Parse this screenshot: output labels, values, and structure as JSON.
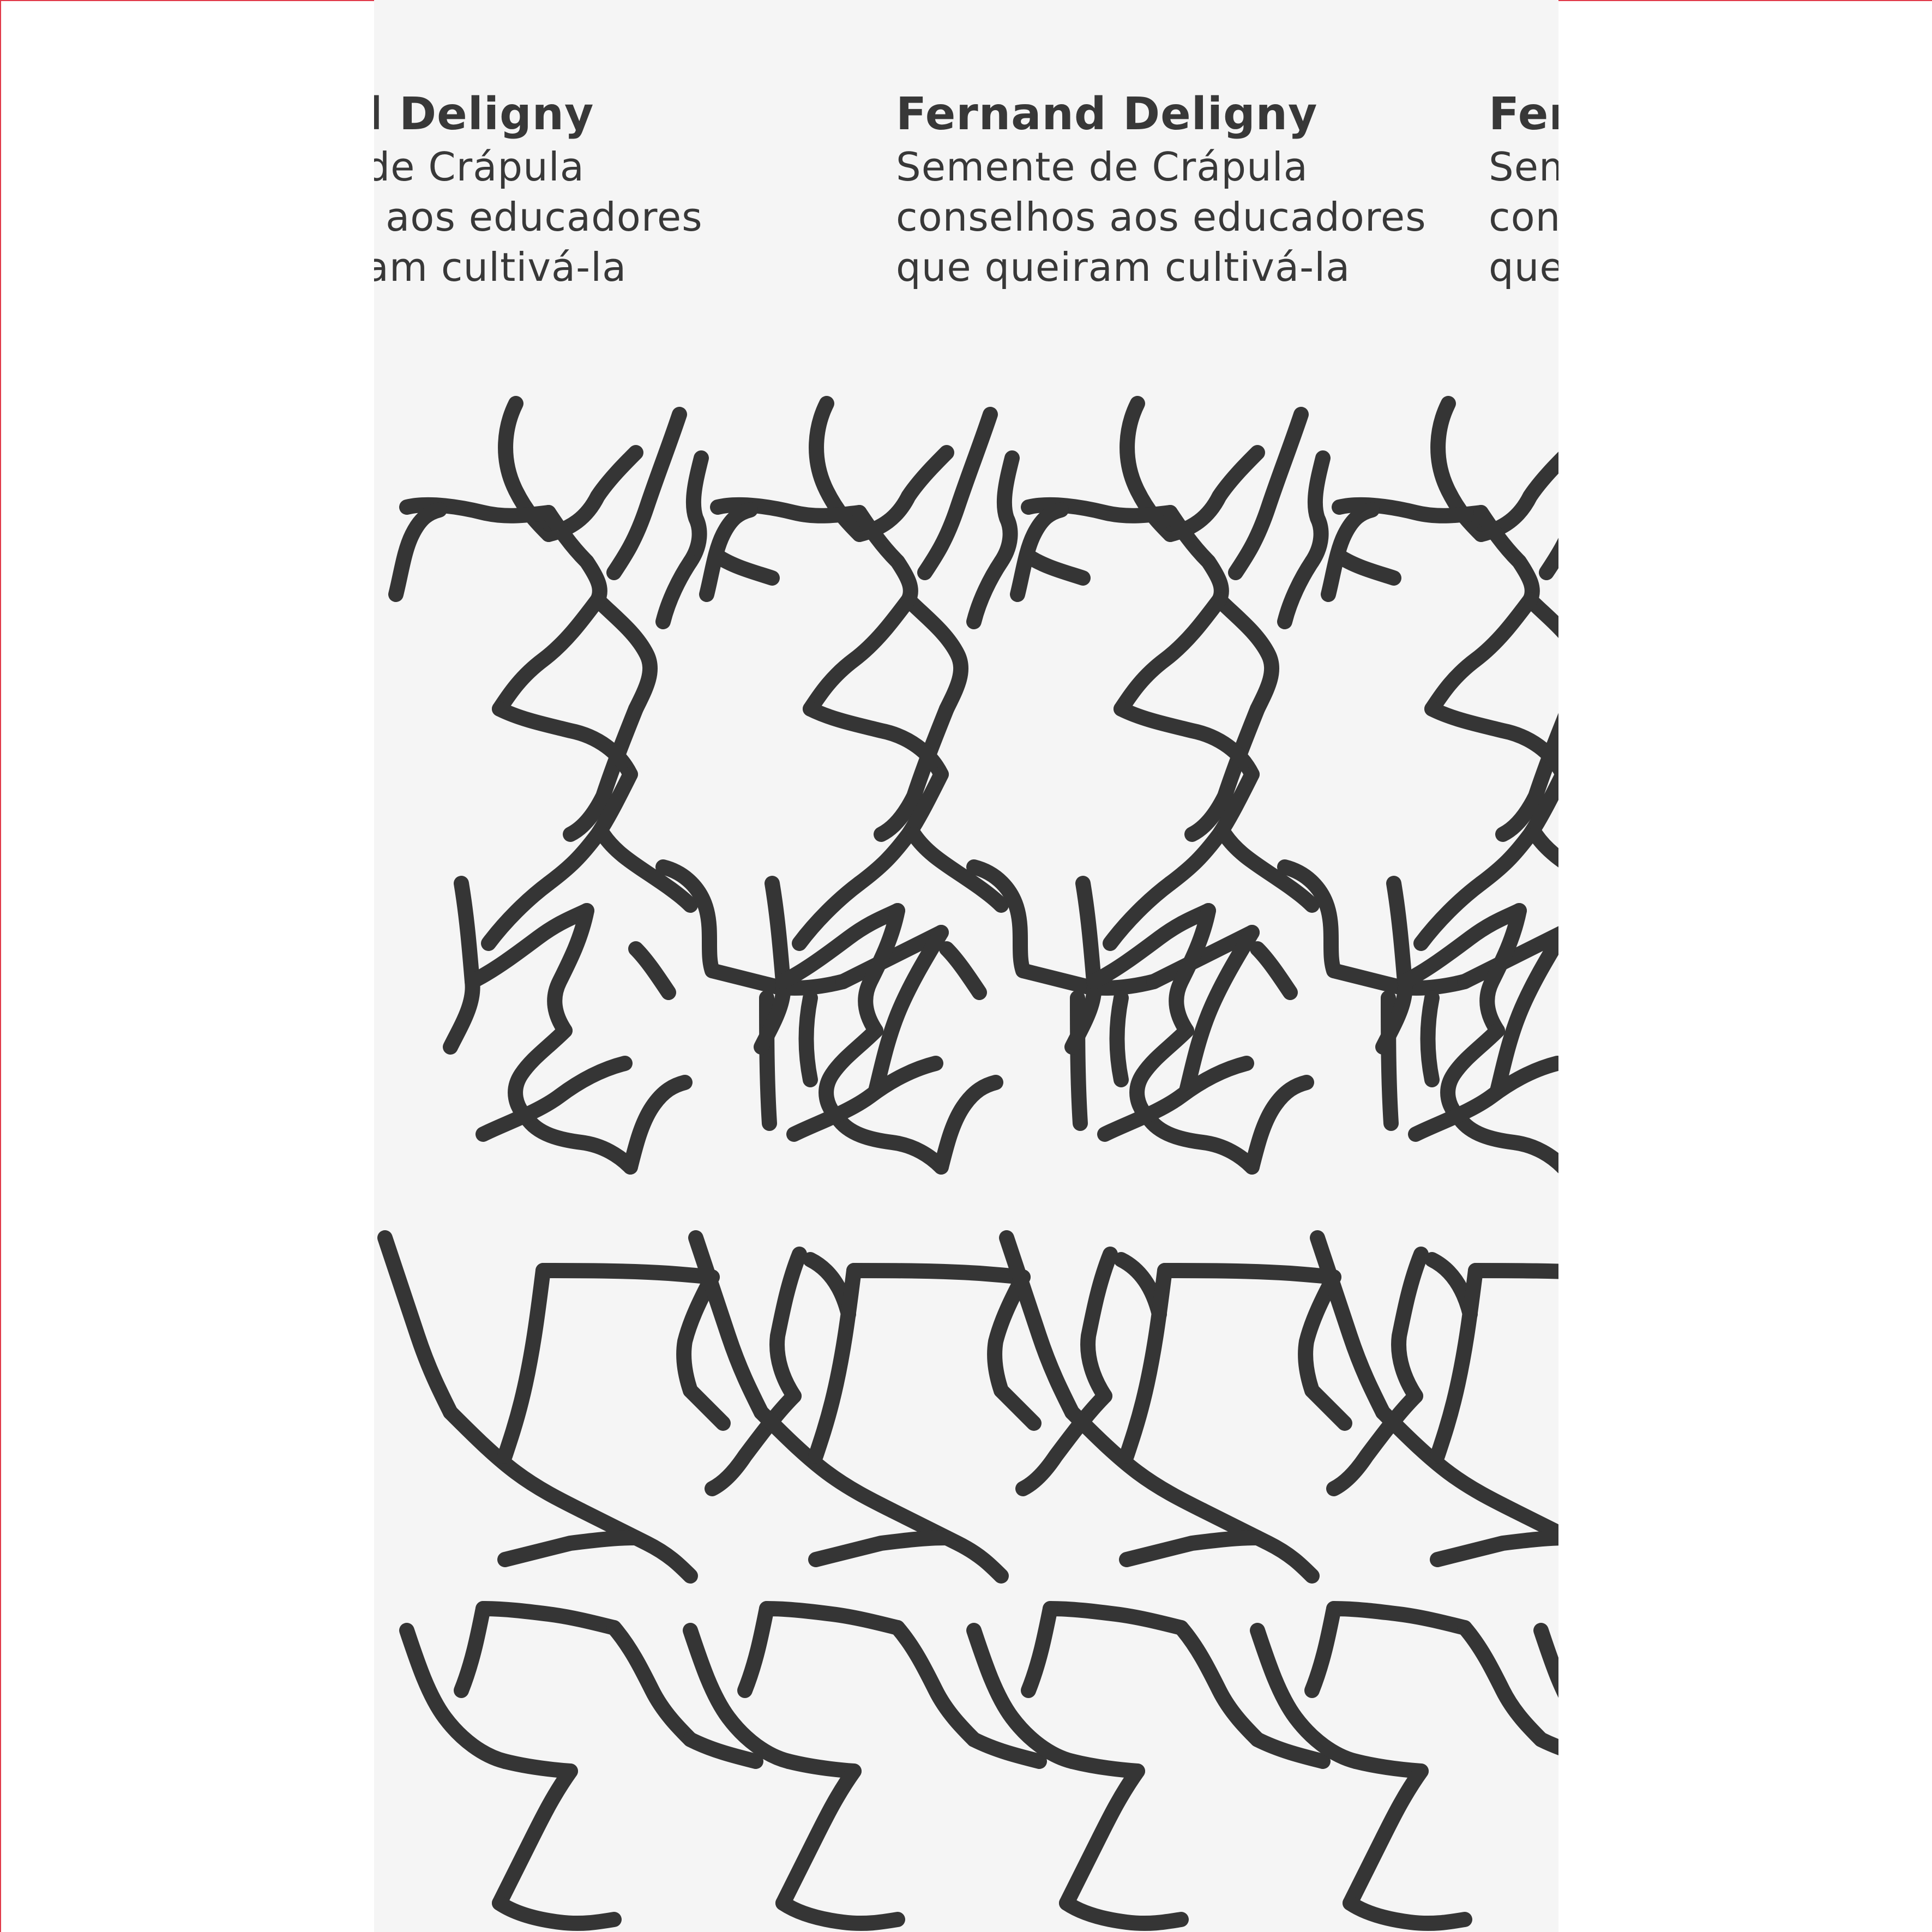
{
  "cover": {
    "author": "Fernand Deligny",
    "title_lines": [
      "Semente de Crápula",
      "conselhos aos educadores",
      "que queiram cultivá-la"
    ],
    "ink_color": "#383838",
    "background_color": "#f5f5f5",
    "frame_color": "#e03a4a"
  }
}
